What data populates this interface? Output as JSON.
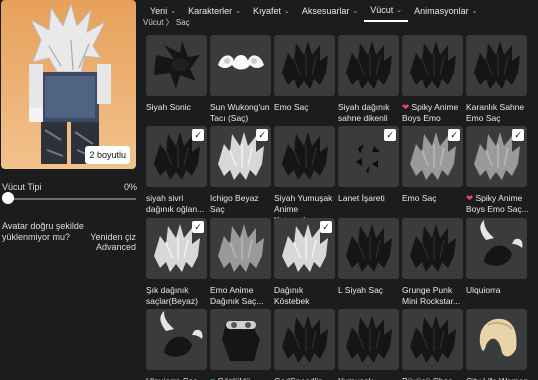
{
  "nav": {
    "tabs": [
      {
        "label": "Yeni",
        "active": false
      },
      {
        "label": "Karakterler",
        "active": false
      },
      {
        "label": "Kıyafet",
        "active": false
      },
      {
        "label": "Aksesuarlar",
        "active": false
      },
      {
        "label": "Vücut",
        "active": true
      },
      {
        "label": "Animasyonlar",
        "active": false
      }
    ]
  },
  "breadcrumb": "Vücut 〉 Saç",
  "avatar": {
    "dimension_button": "2 boyutlu"
  },
  "body_type": {
    "label": "Vücut Tipi",
    "value": "0%",
    "level": 0
  },
  "warning": "Avatar doğru şekilde yüklenmiyor mu?",
  "redraw_label": "Yeniden çiz",
  "advanced_label": "Advanced",
  "items": [
    {
      "name": "Siyah Sonic",
      "selected": false,
      "style": "sonic"
    },
    {
      "name": "Sun Wukong'un Tacı (Saç)",
      "selected": false,
      "style": "crown"
    },
    {
      "name": "Emo Saç",
      "selected": false,
      "style": "dark"
    },
    {
      "name": "Siyah dağınık sahne dikenli saç",
      "selected": false,
      "style": "dark"
    },
    {
      "name": "Spiky Anime Boys Emo Saçla...",
      "selected": false,
      "style": "dark",
      "mark": "red"
    },
    {
      "name": "Karanlık Sahne Emo Saç",
      "selected": false,
      "style": "dark"
    },
    {
      "name": "siyah sivri dağınık oğlan...",
      "selected": true,
      "style": "dark"
    },
    {
      "name": "Ichigo Beyaz Saç",
      "selected": true,
      "style": "white"
    },
    {
      "name": "Siyah Yumuşak Anime Katmanlı...",
      "selected": false,
      "style": "dark"
    },
    {
      "name": "Lanet İşareti",
      "selected": true,
      "style": "marks"
    },
    {
      "name": "Emo Saç",
      "selected": true,
      "style": "gray"
    },
    {
      "name": "Spiky Anime Boys Emo Saç...",
      "selected": true,
      "style": "gray",
      "mark": "red"
    },
    {
      "name": "Şık dağınık saçlar(Beyaz)",
      "selected": true,
      "style": "white"
    },
    {
      "name": "Emo Anime Dağınık Saç...",
      "selected": false,
      "style": "gray"
    },
    {
      "name": "Dağınık Köstebek Anim...",
      "selected": true,
      "style": "white"
    },
    {
      "name": "L Siyah Saç",
      "selected": false,
      "style": "dark"
    },
    {
      "name": "Grunge Punk Mini Rockstar...",
      "selected": false,
      "style": "dark"
    },
    {
      "name": "Ulquiorra",
      "selected": false,
      "style": "horn"
    },
    {
      "name": "Ulquiorra Saç",
      "selected": false,
      "style": "horn"
    },
    {
      "name": "Gözlüklü",
      "selected": false,
      "style": "goggles",
      "mark": "green"
    },
    {
      "name": "GodSpeed'in",
      "selected": false,
      "style": "dark"
    },
    {
      "name": "Yumuşak Dağınık",
      "selected": false,
      "style": "dark"
    },
    {
      "name": "Büyücü Chos",
      "selected": false,
      "style": "dark"
    },
    {
      "name": "City Life Woman",
      "selected": false,
      "style": "blonde"
    }
  ],
  "colors": {
    "background": "#1b1c1e",
    "card": "#393b3d",
    "avatar_bg": "#e7a05a"
  }
}
